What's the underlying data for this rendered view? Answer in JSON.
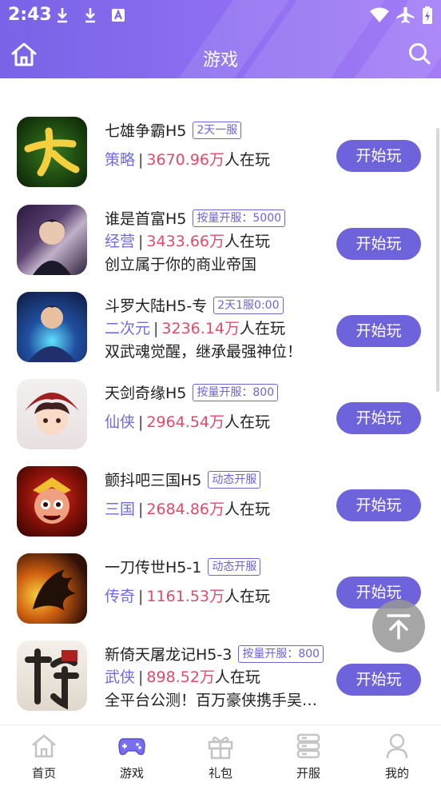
{
  "status_bar": {
    "time": "2:43"
  },
  "header": {
    "title": "游戏"
  },
  "games": [
    {
      "name": "七雄争霸H5",
      "tag": "2天一服",
      "category": "策略",
      "separator": "|",
      "count": "3670.96万",
      "count_suffix": "人在玩",
      "description": "",
      "button": "开始玩"
    },
    {
      "name": "谁是首富H5",
      "tag": "按量开服：5000",
      "category": "经营",
      "separator": "|",
      "count": "3433.66万",
      "count_suffix": "人在玩",
      "description": "创立属于你的商业帝国",
      "button": "开始玩"
    },
    {
      "name": "斗罗大陆H5-专",
      "tag": "2天1服0:00",
      "category": "二次元",
      "separator": "|",
      "count": "3236.14万",
      "count_suffix": "人在玩",
      "description": "双武魂觉醒，继承最强神位！",
      "button": "开始玩"
    },
    {
      "name": "天剑奇缘H5",
      "tag": "按量开服：800",
      "category": "仙侠",
      "separator": "|",
      "count": "2964.54万",
      "count_suffix": "人在玩",
      "description": "",
      "button": "开始玩"
    },
    {
      "name": "颤抖吧三国H5",
      "tag": "动态开服",
      "category": "三国",
      "separator": "|",
      "count": "2684.86万",
      "count_suffix": "人在玩",
      "description": "",
      "button": "开始玩"
    },
    {
      "name": "一刀传世H5-1",
      "tag": "动态开服",
      "category": "传奇",
      "separator": "|",
      "count": "1161.53万",
      "count_suffix": "人在玩",
      "description": "",
      "button": "开始玩"
    },
    {
      "name": "新倚天屠龙记H5-3",
      "tag": "按量开服：800",
      "category": "武侠",
      "separator": "|",
      "count": "898.52万",
      "count_suffix": "人在玩",
      "description": "全平台公测！百万豪侠携手吴…",
      "button": "开始玩"
    }
  ],
  "bottom_nav": [
    {
      "label": "首页",
      "icon": "home-icon",
      "active": false
    },
    {
      "label": "游戏",
      "icon": "gamepad-icon",
      "active": true
    },
    {
      "label": "礼包",
      "icon": "gift-icon",
      "active": false
    },
    {
      "label": "开服",
      "icon": "server-icon",
      "active": false
    },
    {
      "label": "我的",
      "icon": "user-icon",
      "active": false
    }
  ],
  "colors": {
    "accent": "#6f63dc",
    "count": "#e24a6a",
    "category": "#6f6be0",
    "header_start": "#7a63e6",
    "header_end": "#a37cf6"
  }
}
